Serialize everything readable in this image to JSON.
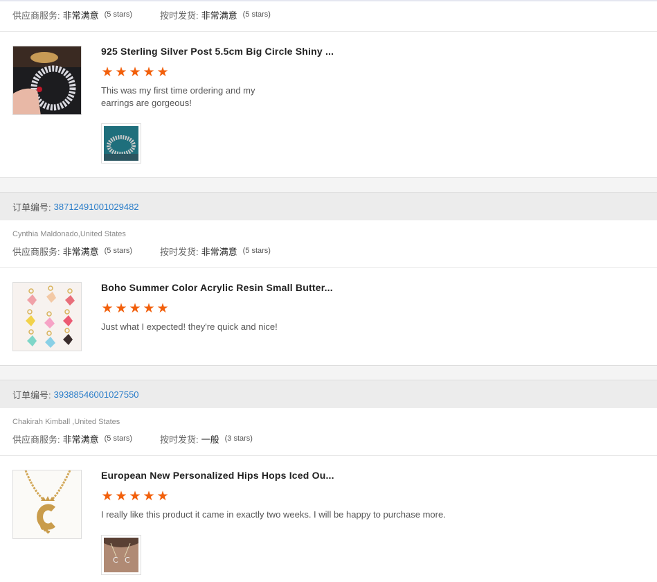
{
  "labels": {
    "supplier_service": "供应商服务:",
    "on_time_delivery": "按时发货:",
    "order_number": "订单编号:"
  },
  "top_review": {
    "supplier_service_value": "非常满意",
    "supplier_service_stars": "(5 stars)",
    "delivery_value": "非常满意",
    "delivery_stars": "(5 stars)",
    "product": {
      "title": "925 Sterling Silver Post 5.5cm Big Circle Shiny ...",
      "rating": 5,
      "review_line1": "This was my first time ordering and my",
      "review_line2": "earrings are gorgeous!"
    }
  },
  "orders": [
    {
      "order_number": "38712491001029482",
      "buyer": "Cynthia Maldonado,United States",
      "supplier_service_value": "非常满意",
      "supplier_service_stars": "(5 stars)",
      "delivery_value": "非常满意",
      "delivery_stars": "(5 stars)",
      "product": {
        "title": "Boho Summer Color Acrylic Resin Small Butter...",
        "rating": 5,
        "review": "Just what I expected! they're quick and nice!"
      }
    },
    {
      "order_number": "39388546001027550",
      "buyer": "Chakirah Kimball ,United States",
      "supplier_service_value": "非常满意",
      "supplier_service_stars": "(5 stars)",
      "delivery_value": "一般",
      "delivery_stars": "(3 stars)",
      "product": {
        "title": "European New Personalized Hips Hops Iced Ou...",
        "rating": 5,
        "review": "I really like this product it came in exactly two weeks. I will be happy to purchase more."
      }
    }
  ],
  "icons": {
    "star": "star-icon"
  },
  "colors": {
    "star": "#f2600c",
    "order_number": "#2a7dc9",
    "order_bar": "#ececec"
  }
}
